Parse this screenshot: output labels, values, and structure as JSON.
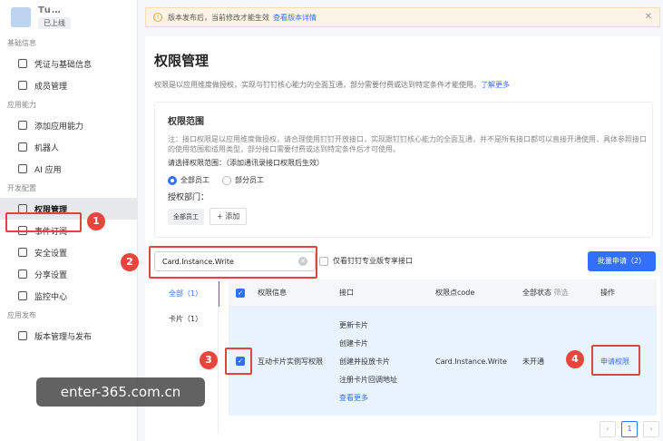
{
  "app": {
    "name": "Tu…",
    "status": "已上线"
  },
  "sidebar": {
    "sections": [
      {
        "title": "基础信息",
        "items": [
          "凭证与基础信息",
          "成员管理"
        ]
      },
      {
        "title": "应用能力",
        "items": [
          "添加应用能力",
          "机器人",
          "AI 应用"
        ]
      },
      {
        "title": "开发配置",
        "items": [
          "权限管理",
          "事件订阅",
          "安全设置",
          "分享设置",
          "监控中心"
        ]
      },
      {
        "title": "应用发布",
        "items": [
          "版本管理与发布"
        ]
      }
    ],
    "active": "权限管理"
  },
  "banner": {
    "text": "版本发布后，当前修改才能生效",
    "link": "查看版本详情"
  },
  "main": {
    "title": "权限管理",
    "desc": "权限是以应用维度做授权，实现与钉钉核心能力的全面互通，部分需要付费或达到特定条件才能使用。",
    "desc_link": "了解更多"
  },
  "scope": {
    "title": "权限范围",
    "note": "注：接口权限是以应用维度做授权，请合理使用钉钉开放接口，实现跟钉钉核心能力的全面互通，并不是所有接口都可以直接开通使用，具体参照接口的使用范围和适用类型，部分接口需要付费或达到特定条件后才可使用。",
    "select_prompt": "请选择权限范围：（添加通讯录接口权限后生效）",
    "radio_all": "全部员工",
    "radio_part": "部分员工",
    "dept_label": "授权部门：",
    "dept_tag": "全部员工",
    "add_label": "+ 添加"
  },
  "search": {
    "value": "Card.Instance.Write"
  },
  "filter": {
    "label": "仅看钉钉专业版专享接口"
  },
  "batch_button": "批量申请（2）",
  "tabs": [
    {
      "label": "全部（1）"
    },
    {
      "label": "卡片（1）"
    }
  ],
  "table": {
    "headers": [
      "权限信息",
      "接口",
      "权限点code",
      "全部状态",
      "筛选",
      "操作"
    ],
    "row": {
      "name": "互动卡片实例写权限",
      "interfaces": [
        "更新卡片",
        "创建卡片",
        "创建并投放卡片",
        "注册卡片回调地址"
      ],
      "more": "查看更多",
      "code": "Card.Instance.Write",
      "status": "未开通",
      "action": "申请权限"
    }
  },
  "pager": {
    "current": "1"
  },
  "annotations": {
    "b1": "1",
    "b2": "2",
    "b3": "3",
    "b4": "4"
  },
  "watermark": "enter-365.com.cn",
  "colors": {
    "accent": "#3370ff",
    "highlight": "#e0443e"
  }
}
